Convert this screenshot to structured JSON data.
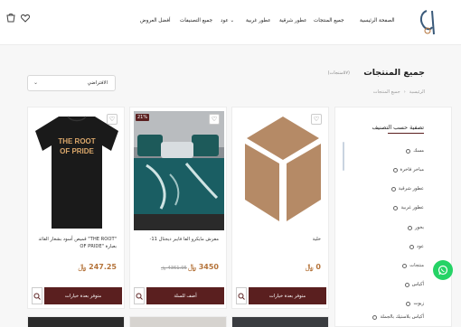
{
  "header": {
    "nav": [
      {
        "label": "الصفحة الرئيسية"
      },
      {
        "label": "جميع المنتجات"
      },
      {
        "label": "عطور شرقية"
      },
      {
        "label": "عطور غربية"
      },
      {
        "label": "عود"
      },
      {
        "label": "جميع التصنيفات"
      },
      {
        "label": "أفضل العروض"
      }
    ],
    "brand_color": "#5a1f1f"
  },
  "page": {
    "title": "جميع المنتجات",
    "count": "(٥٧منتجات)",
    "breadcrumbs": [
      "الرئيسية",
      "جميع المنتجات"
    ],
    "sort_value": "الافتراضي"
  },
  "filter": {
    "title": "تصفية حسب التصنيف",
    "items": [
      "مسك",
      "مباخر فاخرة",
      "عطور شرقية",
      "عطور غربية",
      "بخور",
      "عود",
      "منتجات",
      "أكياس",
      "زيوت",
      "أكياس بلاستيك بالجملة"
    ]
  },
  "products": [
    {
      "name": "خلية",
      "price": "0",
      "old_price": "",
      "button": "متوفر بعدة خيارات",
      "badge": "",
      "image": "placeholder-box"
    },
    {
      "name": "مفرش مايكرو الفا فايبر ديجتال 11-",
      "price": "3450",
      "old_price": "4361.95",
      "button": "أضف للسلة",
      "badge": "21%",
      "image": "bedding"
    },
    {
      "name": "\"THE ROOT\" قميص أسود بشعار القائد بعبارة \"OF PRIDE",
      "price": "247.25",
      "old_price": "",
      "button": "متوفر بعدة خيارات",
      "badge": "",
      "image": "black-tshirt"
    }
  ],
  "tshirt_text": [
    "THE ROOT",
    "OF PRIDE"
  ],
  "colors": {
    "accent": "#5a1f1f",
    "price": "#b5743b",
    "whatsapp": "#25d366",
    "placeholder": "#b58a66"
  }
}
